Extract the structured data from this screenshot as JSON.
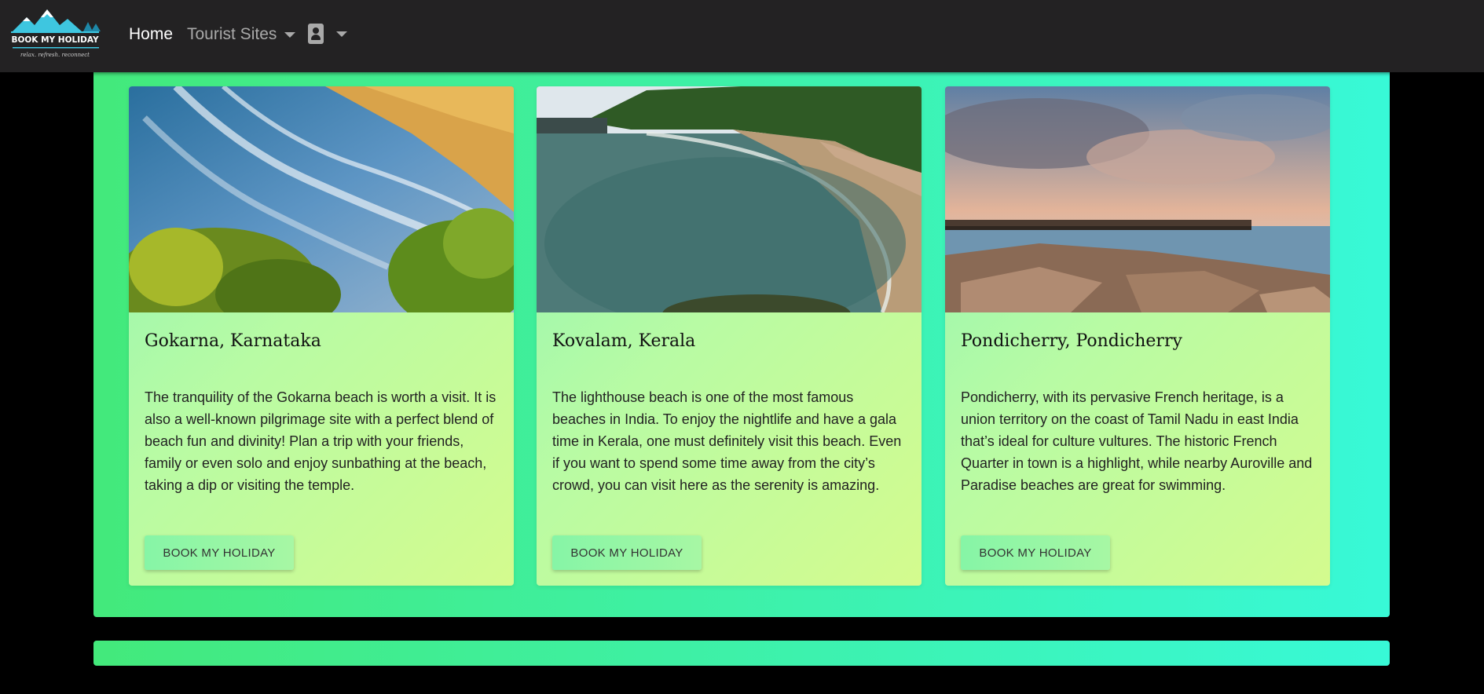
{
  "nav": {
    "brand": "BOOK MY HOLIDAY",
    "tagline": "relax. refresh. reconnect",
    "home_label": "Home",
    "sites_label": "Tourist Sites",
    "profile_icon": "contact-card-icon"
  },
  "cards": [
    {
      "title": "Gokarna, Karnataka",
      "text": "The tranquility of the Gokarna beach is worth a visit. It is also a well-known pilgrimage site with a perfect blend of beach fun and divinity! Plan a trip with your friends, family or even solo and enjoy sunbathing at the beach, taking a dip or visiting the temple.",
      "button": "BOOK MY HOLIDAY"
    },
    {
      "title": "Kovalam, Kerala",
      "text": "The lighthouse beach is one of the most famous beaches in India. To enjoy the nightlife and have a gala time in Kerala, one must definitely visit this beach. Even if you want to spend some time away from the city’s crowd, you can visit here as the serenity is amazing.",
      "button": "BOOK MY HOLIDAY"
    },
    {
      "title": "Pondicherry, Pondicherry",
      "text": "Pondicherry, with its pervasive French heritage, is a union territory on the coast of Tamil Nadu in east India that’s ideal for culture vultures. The historic French Quarter in town is a highlight, while nearby Auroville and Paradise beaches are great for swimming.",
      "button": "BOOK MY HOLIDAY"
    }
  ],
  "colors": {
    "navbar": "#232223",
    "gradient_start": "#43e97b",
    "gradient_end": "#38f9d7",
    "background": "#000000"
  }
}
